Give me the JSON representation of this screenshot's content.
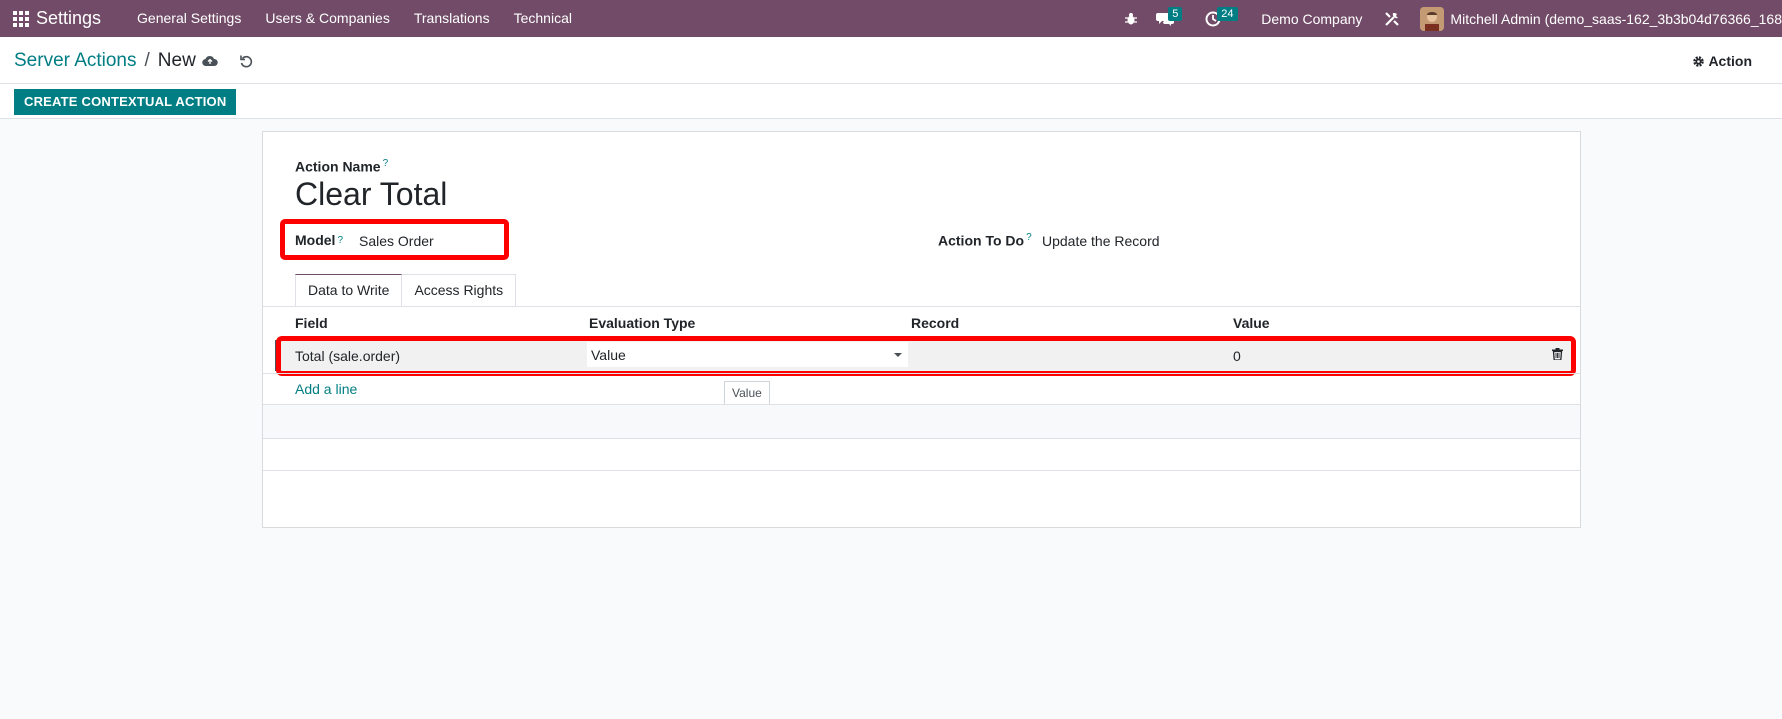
{
  "navbar": {
    "brand": "Settings",
    "menu": [
      "General Settings",
      "Users & Companies",
      "Translations",
      "Technical"
    ],
    "messages_badge": "5",
    "activities_badge": "24",
    "company": "Demo Company",
    "user": "Mitchell Admin (demo_saas-162_3b3b04d76366_168"
  },
  "control_panel": {
    "breadcrumb_parent": "Server Actions",
    "breadcrumb_sep": "/",
    "breadcrumb_current": "New",
    "action_label": "Action",
    "create_button": "CREATE CONTEXTUAL ACTION"
  },
  "form": {
    "action_name_label": "Action Name",
    "help_mark": "?",
    "title": "Clear Total",
    "model_label": "Model",
    "model_value": "Sales Order",
    "action_todo_label": "Action To Do",
    "action_todo_value": "Update the Record",
    "tabs": [
      {
        "label": "Data to Write",
        "active": true
      },
      {
        "label": "Access Rights",
        "active": false
      }
    ],
    "table": {
      "headers": [
        "Field",
        "Evaluation Type",
        "Record",
        "Value"
      ],
      "rows": [
        {
          "field": "Total (sale.order)",
          "evaluation_type": "Value",
          "record": "",
          "value": "0"
        }
      ],
      "add_line": "Add a line",
      "tooltip": "Value"
    }
  },
  "colors": {
    "navbar": "#714b67",
    "primary": "#017e84",
    "highlight": "#ff0000"
  }
}
